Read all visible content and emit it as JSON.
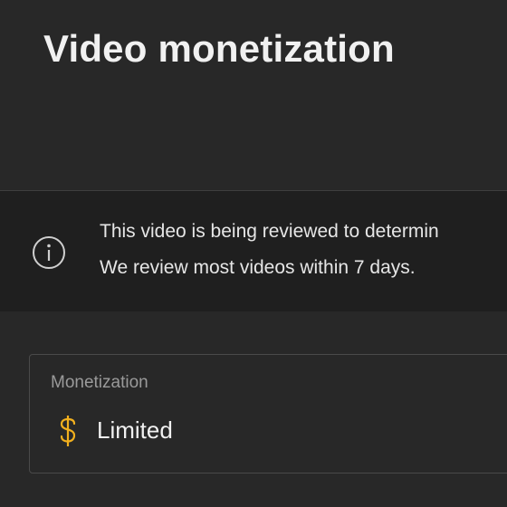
{
  "page": {
    "title": "Video monetization"
  },
  "notice": {
    "icon": "info-icon",
    "line1": "This video is being reviewed to determin",
    "line2": "We review most videos within 7 days."
  },
  "monetization": {
    "label": "Monetization",
    "value": "Limited",
    "icon": "dollar-icon",
    "icon_color": "#f2b01e"
  },
  "colors": {
    "background": "#282828",
    "banner": "#1f1f1f",
    "text_primary": "#f1f1f1",
    "text_secondary": "#9a9a9a"
  }
}
